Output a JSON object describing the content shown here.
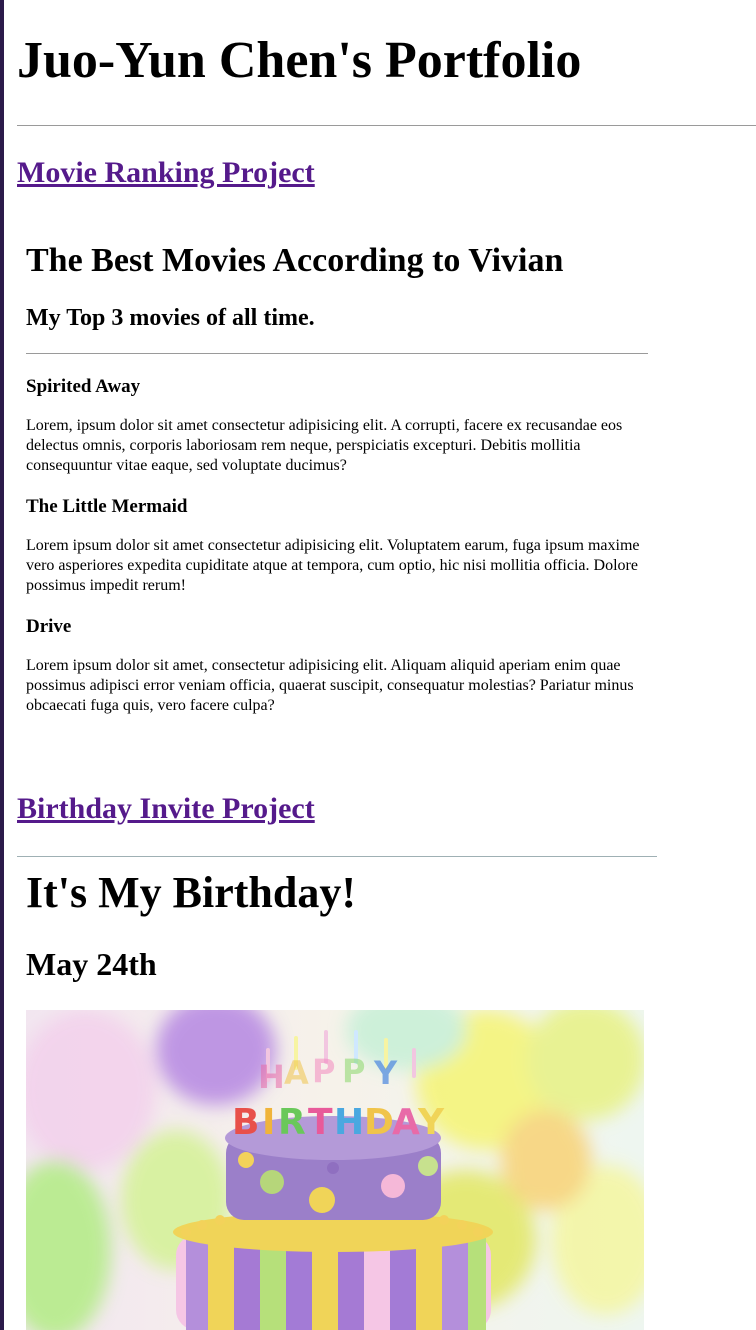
{
  "page": {
    "title": "Juo-Yun Chen's Portfolio"
  },
  "projects": {
    "movie_link": "Movie Ranking Project",
    "birthday_link": "Birthday Invite Project"
  },
  "movies": {
    "heading": "The Best Movies According to Vivian",
    "subheading": "My Top 3 movies of all time.",
    "items": [
      {
        "title": "Spirited Away",
        "description": "Lorem, ipsum dolor sit amet consectetur adipisicing elit. A corrupti, facere ex recusandae eos delectus omnis, corporis laboriosam rem neque, perspiciatis excepturi. Debitis mollitia consequuntur vitae eaque, sed voluptate ducimus?"
      },
      {
        "title": "The Little Mermaid",
        "description": "Lorem ipsum dolor sit amet consectetur adipisicing elit. Voluptatem earum, fuga ipsum maxime vero asperiores expedita cupiditate atque at tempora, cum optio, hic nisi mollitia officia. Dolore possimus impedit rerum!"
      },
      {
        "title": "Drive",
        "description": "Lorem ipsum dolor sit amet, consectetur adipisicing elit. Aliquam aliquid aperiam enim quae possimus adipisci error veniam officia, quaerat suscipit, consequatur molestias? Pariatur minus obcaecati fuga quis, vero facere culpa?"
      }
    ]
  },
  "birthday": {
    "heading": "It's My Birthday!",
    "date": "May 24th",
    "image_letters": "HAPPY BIRTHDAY"
  },
  "colors": {
    "link": "#551a8b",
    "rule": "#9a9a9a"
  }
}
